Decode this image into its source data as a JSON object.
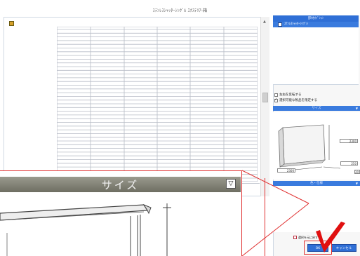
{
  "window": {
    "title": "ｽﾃﾝﾚｽｼｬｯﾀｰｼﾝｸﾞﾙ ｴｸｽﾃﾘｱ-箱"
  },
  "tree": {
    "header": "部材ｵﾌﾟｼｮﾝ",
    "selected_item": "ｽﾃﾝﾚｽｼｬｯﾀｰｼﾝｸﾞﾙ"
  },
  "options": {
    "mirror_label": "左右を反転する",
    "mirror_checked": false,
    "spec_label": "選択可能な製品を限定する",
    "spec_checked": true
  },
  "size_section": {
    "label": "サイズ"
  },
  "dimensions": {
    "right_height": "2300",
    "left_width": "2300",
    "bottom_right": "250",
    "bottom_depth": "20"
  },
  "color_section": {
    "label": "色・仕様"
  },
  "footer": {
    "checkbox_label": "選択を元に戻す",
    "ok_label": "OK",
    "cancel_label": "キャンセル"
  },
  "zoom": {
    "title": "サイズ",
    "dropdown_symbol": "▽"
  },
  "colors": {
    "accent": "#2f6fd6",
    "highlight": "#e03030"
  },
  "icons": [
    "settings-icon",
    "part-icon",
    "dropdown-icon",
    "checkmark-icon"
  ]
}
